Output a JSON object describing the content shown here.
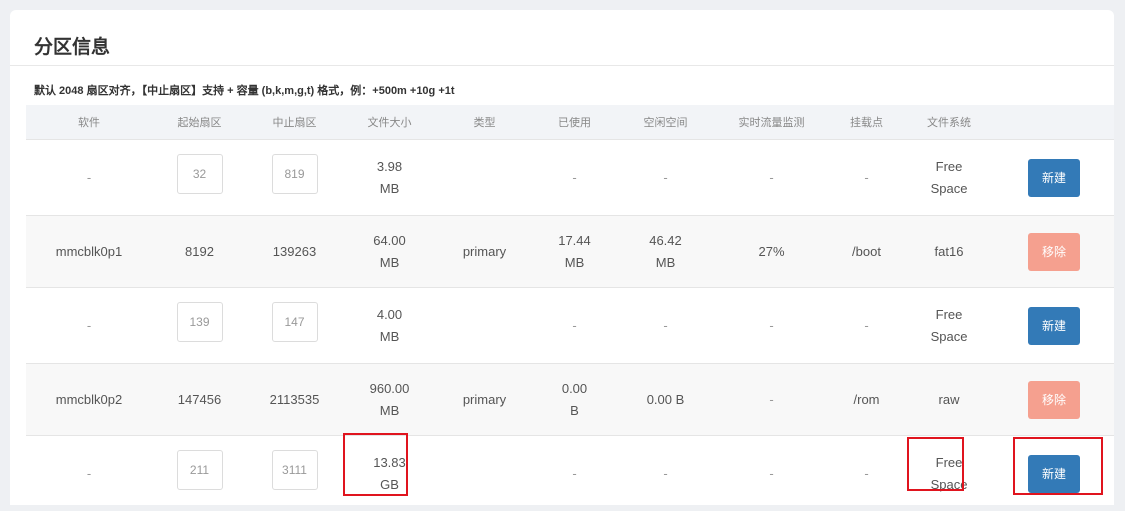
{
  "header": {
    "title": "分区信息",
    "note": "默认 2048 扇区对齐，【中止扇区】支持 + 容量 (b,k,m,g,t) 格式，例：+500m +10g +1t"
  },
  "columns": [
    "软件",
    "起始扇区",
    "中止扇区",
    "文件大小",
    "类型",
    "已使用",
    "空闲空间",
    "实时流量监测",
    "挂载点",
    "文件系统",
    ""
  ],
  "rows": [
    {
      "kind": "free",
      "software": "-",
      "start": "32",
      "end": "819",
      "size1": "3.98",
      "size2": "MB",
      "type": "",
      "used1": "-",
      "used2": "",
      "free1": "-",
      "free2": "",
      "monitor": "-",
      "mount": "-",
      "fs1": "Free",
      "fs2": "Space",
      "action": "新建"
    },
    {
      "kind": "used",
      "software": "mmcblk0p1",
      "start": "8192",
      "end": "139263",
      "size1": "64.00",
      "size2": "MB",
      "type": "primary",
      "used1": "17.44",
      "used2": "MB",
      "free1": "46.42",
      "free2": "MB",
      "monitor": "27%",
      "mount": "/boot",
      "fs1": "fat16",
      "fs2": "",
      "action": "移除"
    },
    {
      "kind": "free",
      "software": "-",
      "start": "139",
      "end": "147",
      "size1": "4.00",
      "size2": "MB",
      "type": "",
      "used1": "-",
      "used2": "",
      "free1": "-",
      "free2": "",
      "monitor": "-",
      "mount": "-",
      "fs1": "Free",
      "fs2": "Space",
      "action": "新建"
    },
    {
      "kind": "used",
      "software": "mmcblk0p2",
      "start": "147456",
      "end": "2113535",
      "size1": "960.00",
      "size2": "MB",
      "type": "primary",
      "used1": "0.00",
      "used2": "B",
      "free1": "0.00 B",
      "free2": "",
      "monitor": "-",
      "mount": "/rom",
      "fs1": "raw",
      "fs2": "",
      "action": "移除"
    },
    {
      "kind": "free",
      "software": "-",
      "start": "211",
      "end": "3111",
      "size1": "13.83",
      "size2": "GB",
      "type": "",
      "used1": "-",
      "used2": "",
      "free1": "-",
      "free2": "",
      "monitor": "-",
      "mount": "-",
      "fs1": "Free",
      "fs2": "Space",
      "action": "新建"
    }
  ],
  "colors": {
    "new_button": "#337ab7",
    "remove_button": "#f5a08f",
    "highlight": "#e0141e"
  }
}
